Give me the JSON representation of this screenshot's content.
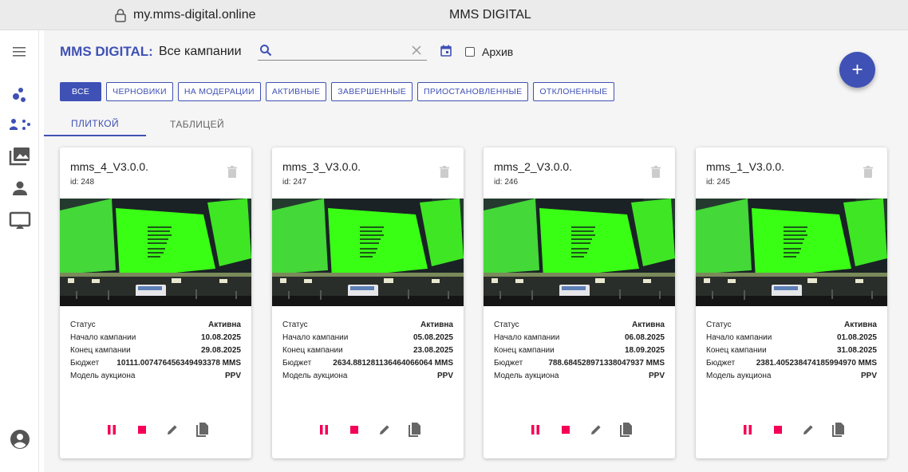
{
  "browser": {
    "url": "my.mms-digital.online",
    "window_title": "MMS DIGITAL"
  },
  "header": {
    "brand": "MMS DIGITAL:",
    "title": "Все кампании",
    "search_value": "",
    "archive_label": "Архив",
    "add_button": "+"
  },
  "filters": [
    {
      "label": "ВСЕ",
      "active": true
    },
    {
      "label": "ЧЕРНОВИКИ",
      "active": false
    },
    {
      "label": "НА МОДЕРАЦИИ",
      "active": false
    },
    {
      "label": "АКТИВНЫЕ",
      "active": false
    },
    {
      "label": "ЗАВЕРШЕННЫЕ",
      "active": false
    },
    {
      "label": "ПРИОСТАНОВЛЕННЫЕ",
      "active": false
    },
    {
      "label": "ОТКЛОНЕННЫЕ",
      "active": false
    }
  ],
  "tabs": [
    {
      "label": "ПЛИТКОЙ",
      "active": true
    },
    {
      "label": "ТАБЛИЦЕЙ",
      "active": false
    }
  ],
  "labels": {
    "status": "Статус",
    "start": "Начало кампании",
    "end": "Конец кампании",
    "budget": "Бюджет",
    "model": "Модель аукциона"
  },
  "campaigns": [
    {
      "name": "mms_4_V3.0.0.",
      "id": "id: 248",
      "status": "Активна",
      "start": "10.08.2025",
      "end": "29.08.2025",
      "budget": "10111.007476456349493378 MMS",
      "model": "PPV"
    },
    {
      "name": "mms_3_V3.0.0.",
      "id": "id: 247",
      "status": "Активна",
      "start": "05.08.2025",
      "end": "23.08.2025",
      "budget": "2634.881281136464066064 MMS",
      "model": "PPV"
    },
    {
      "name": "mms_2_V3.0.0.",
      "id": "id: 246",
      "status": "Активна",
      "start": "06.08.2025",
      "end": "18.09.2025",
      "budget": "788.684528971338047937 MMS",
      "model": "PPV"
    },
    {
      "name": "mms_1_V3.0.0.",
      "id": "id: 245",
      "status": "Активна",
      "start": "01.08.2025",
      "end": "31.08.2025",
      "budget": "2381.405238474185994970 MMS",
      "model": "PPV"
    }
  ],
  "colors": {
    "accent": "#3f51b5",
    "danger": "#f50057",
    "screen_green": "#39ff14"
  },
  "icons": [
    "lock-icon",
    "menu-icon",
    "bubble-chart-icon",
    "group-icon",
    "photo-library-icon",
    "person-icon",
    "cast-icon",
    "account-circle-icon",
    "search-icon",
    "close-icon",
    "calendar-icon",
    "delete-icon",
    "pause-icon",
    "stop-icon",
    "edit-icon",
    "copy-icon"
  ]
}
